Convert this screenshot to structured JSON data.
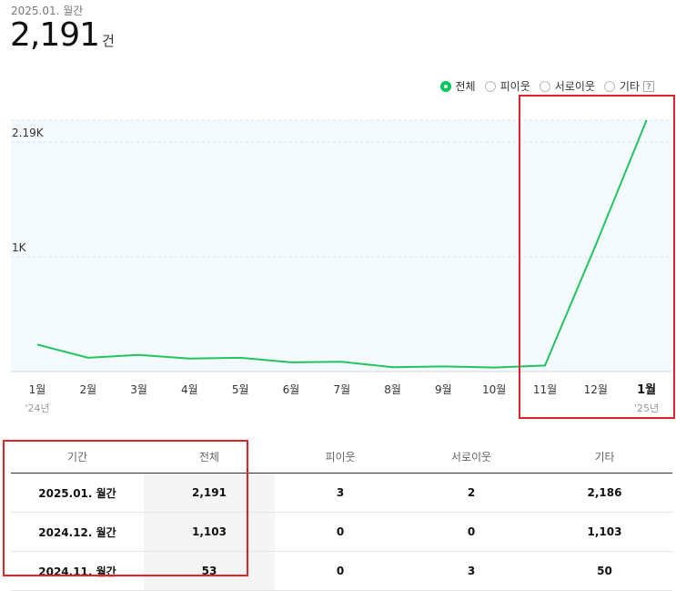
{
  "header": {
    "period": "2025.01. 월간",
    "total": "2,191",
    "unit": "건"
  },
  "legend": {
    "options": [
      "전체",
      "피이웃",
      "서로이웃",
      "기타"
    ],
    "selected": "전체",
    "help": "?"
  },
  "chart_data": {
    "type": "line",
    "categories": [
      "1월",
      "2월",
      "3월",
      "4월",
      "5월",
      "6월",
      "7월",
      "8월",
      "9월",
      "10월",
      "11월",
      "12월",
      "1월"
    ],
    "year_labels": [
      {
        "index": 0,
        "label": "'24년"
      },
      {
        "index": 12,
        "label": "'25년"
      }
    ],
    "bold_index": 12,
    "series": [
      {
        "values": [
          235,
          120,
          145,
          113,
          120,
          80,
          85,
          38,
          45,
          35,
          53,
          1103,
          2191
        ],
        "color": "#22c55e"
      }
    ],
    "yticks": [
      {
        "value": 1000,
        "label": "1K"
      },
      {
        "value": 2000,
        "label": "2.19K"
      }
    ],
    "ylim": [
      0,
      2191
    ],
    "grid": true,
    "background": "#f4fafd"
  },
  "table": {
    "headers": [
      "기간",
      "전체",
      "피이웃",
      "서로이웃",
      "기타"
    ],
    "rows": [
      [
        "2025.01. 월간",
        "2,191",
        "3",
        "2",
        "2,186"
      ],
      [
        "2024.12. 월간",
        "1,103",
        "0",
        "0",
        "1,103"
      ],
      [
        "2024.11. 월간",
        "53",
        "0",
        "3",
        "50"
      ]
    ]
  },
  "colors": {
    "accent": "#03c75a",
    "line": "#22c55e",
    "highlight": "#e0242c"
  }
}
